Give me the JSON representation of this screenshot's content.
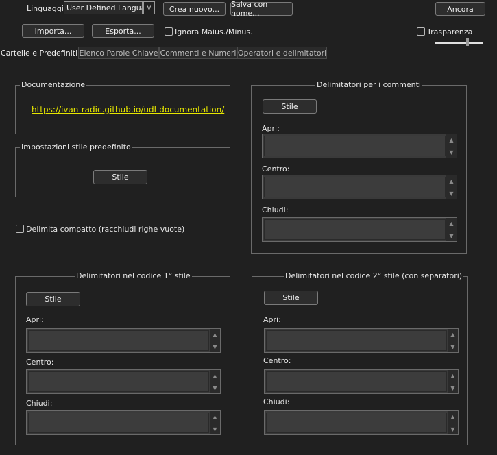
{
  "toolbar": {
    "language_label": "Linguaggio",
    "language_value": "User Defined Languag",
    "create_new": "Crea nuovo...",
    "save_as": "Salva con nome...",
    "dock": "Ancora",
    "import": "Importa...",
    "export": "Esporta...",
    "ignore_case": "Ignora Maius./Minus.",
    "transparency": "Trasparenza",
    "transparency_level": 0.7
  },
  "tabs": [
    {
      "label": "Cartelle e Predefiniti",
      "active": true
    },
    {
      "label": "Elenco Parole Chiave",
      "active": false
    },
    {
      "label": "Commenti e Numeri",
      "active": false
    },
    {
      "label": "Operatori e delimitatori",
      "active": false
    }
  ],
  "documentation": {
    "title": "Documentazione",
    "link": "https://ivan-radic.github.io/udl-documentation/"
  },
  "default_style": {
    "title": "Impostazioni stile predefinito",
    "style_button": "Stile"
  },
  "compact_fold": {
    "label": "Delimita compatto (racchiudi righe vuote)"
  },
  "comment_delims": {
    "title": "Delimitatori per i commenti",
    "style_button": "Stile",
    "open": "Apri:",
    "middle": "Centro:",
    "close": "Chiudi:"
  },
  "code_style1": {
    "title": "Delimitatori nel codice 1° stile",
    "style_button": "Stile",
    "open": "Apri:",
    "middle": "Centro:",
    "close": "Chiudi:"
  },
  "code_style2": {
    "title": "Delimitatori nel codice 2° stile (con separatori)",
    "style_button": "Stile",
    "open": "Apri:",
    "middle": "Centro:",
    "close": "Chiudi:"
  },
  "icons": {
    "combo_arrow": "chevron-down-icon",
    "scroll_up": "arrow-up-icon",
    "scroll_down": "arrow-down-icon"
  },
  "colors": {
    "background": "#202020",
    "link": "#e6e600"
  }
}
